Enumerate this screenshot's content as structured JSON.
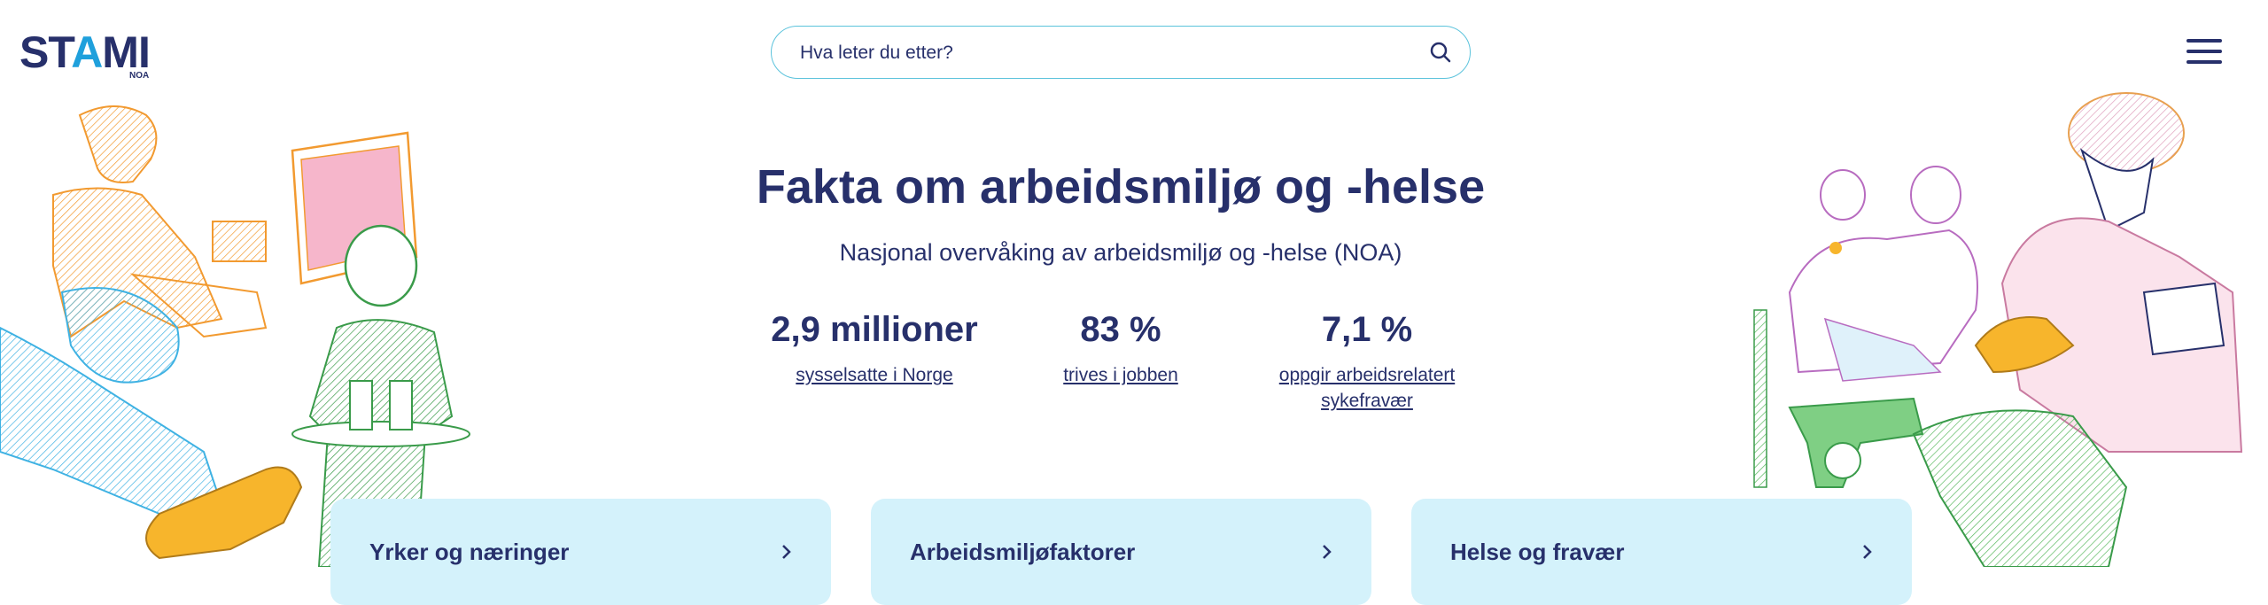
{
  "header": {
    "logo_text": "STAMI",
    "logo_sub": "NOA",
    "search_placeholder": "Hva leter du etter?",
    "search_icon": "search-icon",
    "menu_icon": "hamburger-menu-icon"
  },
  "hero": {
    "title": "Fakta om arbeidsmiljø og -helse",
    "subtitle": "Nasjonal overvåking av arbeidsmiljø og -helse (NOA)"
  },
  "stats": [
    {
      "value": "2,9 millioner",
      "label": "sysselsatte i Norge"
    },
    {
      "value": "83 %",
      "label": "trives i jobben"
    },
    {
      "value": "7,1 %",
      "label": "oppgir arbeidsrelatert sykefravær"
    }
  ],
  "cards": [
    {
      "title": "Yrker og næringer",
      "icon": "chevron-right-icon"
    },
    {
      "title": "Arbeidsmiljøfaktorer",
      "icon": "chevron-right-icon"
    },
    {
      "title": "Helse og fravær",
      "icon": "chevron-right-icon"
    }
  ],
  "colors": {
    "brand_navy": "#27306b",
    "brand_blue": "#1fa0dc",
    "card_bg": "#d4f2fb",
    "search_border": "#5cc3dc"
  }
}
